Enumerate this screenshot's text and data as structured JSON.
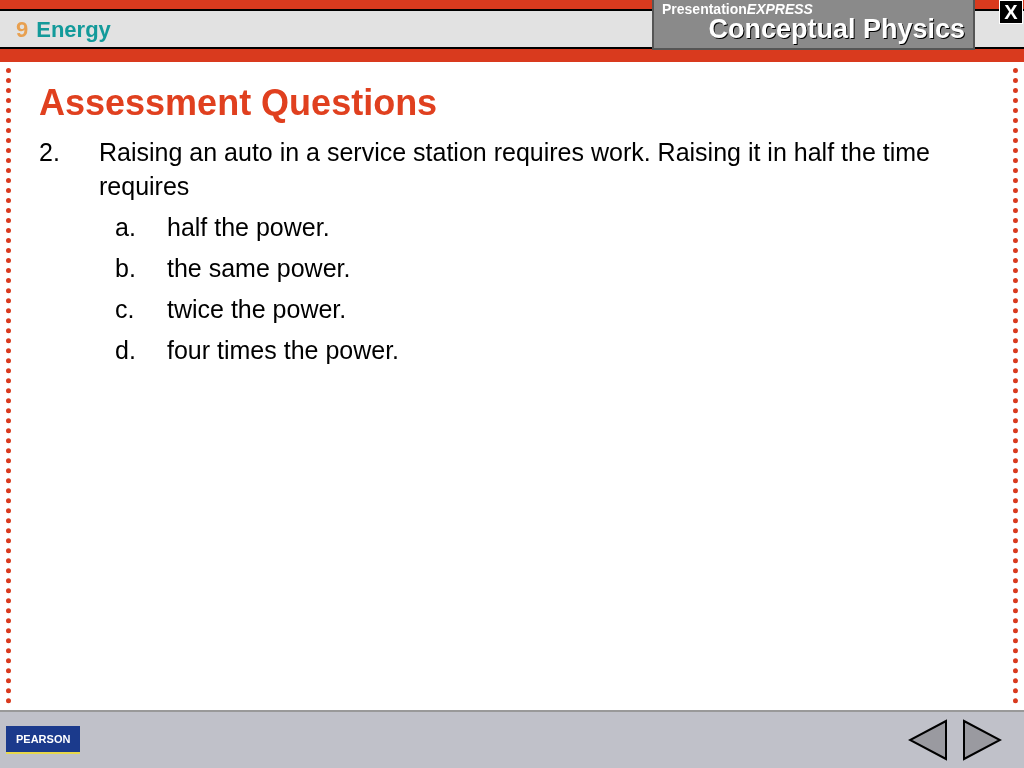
{
  "header": {
    "chapter_number": "9",
    "chapter_title": "Energy",
    "logo_top": "Presentation",
    "logo_top_bold": "EXPRESS",
    "logo_main": "Conceptual Physics",
    "close": "X"
  },
  "slide": {
    "title": "Assessment Questions",
    "question": {
      "number": "2.",
      "text": "Raising an auto in a service station requires work. Raising it in half the time requires",
      "options": [
        {
          "letter": "a.",
          "text": "half the power."
        },
        {
          "letter": "b.",
          "text": "the same power."
        },
        {
          "letter": "c.",
          "text": "twice the power."
        },
        {
          "letter": "d.",
          "text": "four times the power."
        }
      ]
    }
  },
  "footer": {
    "publisher": "PEARSON"
  }
}
